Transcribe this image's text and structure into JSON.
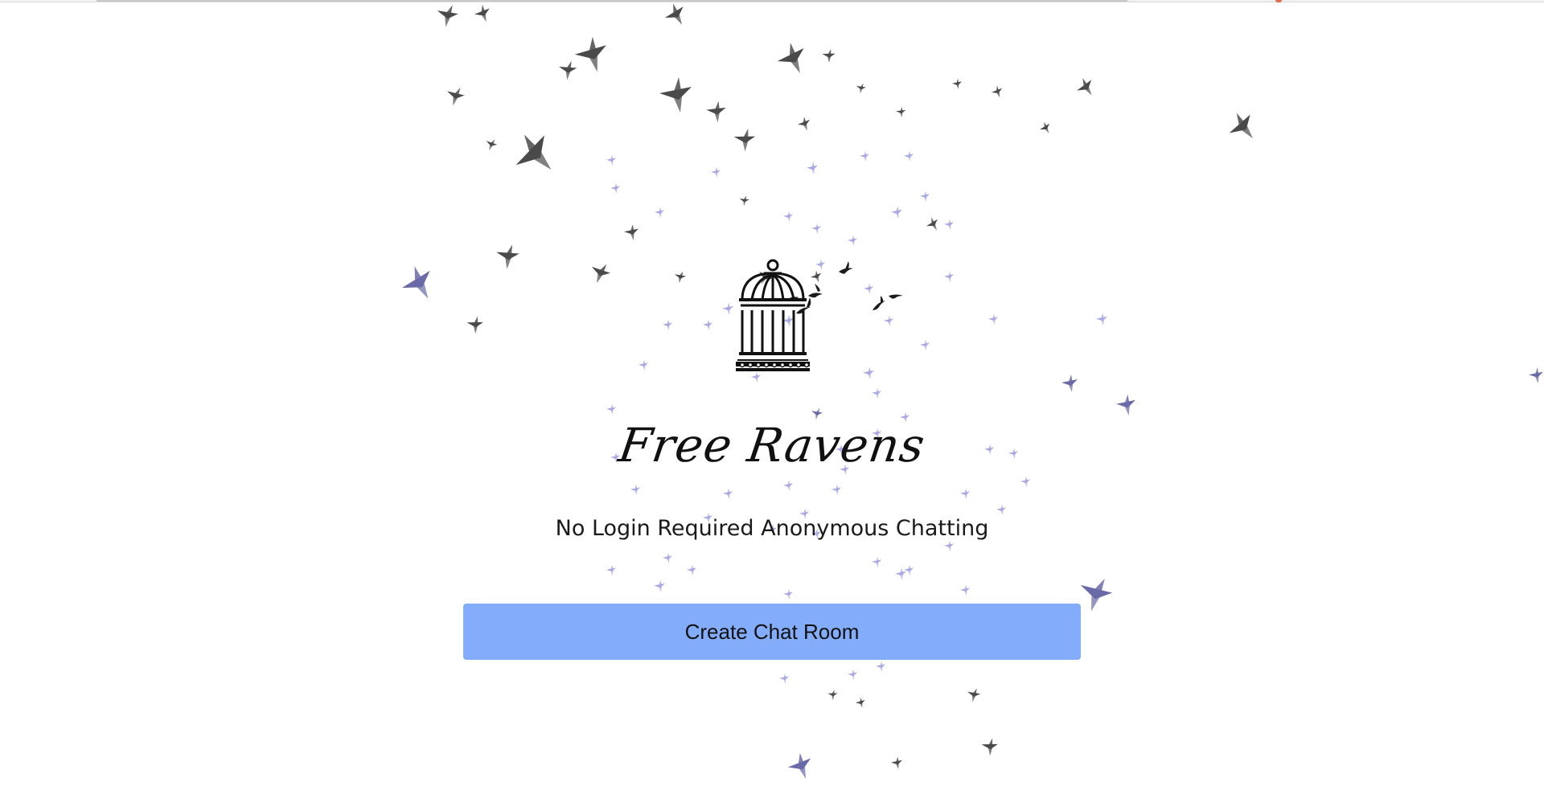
{
  "brand": {
    "name": "Free Ravens",
    "logo_icon": "birdcage-icon"
  },
  "tagline": "No Login Required Anonymous Chatting",
  "actions": {
    "create_label": "Create Chat Room"
  },
  "background": {
    "icon": "flying-birds-icon"
  },
  "colors": {
    "button": "#83adfa",
    "bird_dark": "#4a4a4a",
    "bird_purple": "#6a6aa8",
    "bird_light": "#a9a9e6"
  }
}
